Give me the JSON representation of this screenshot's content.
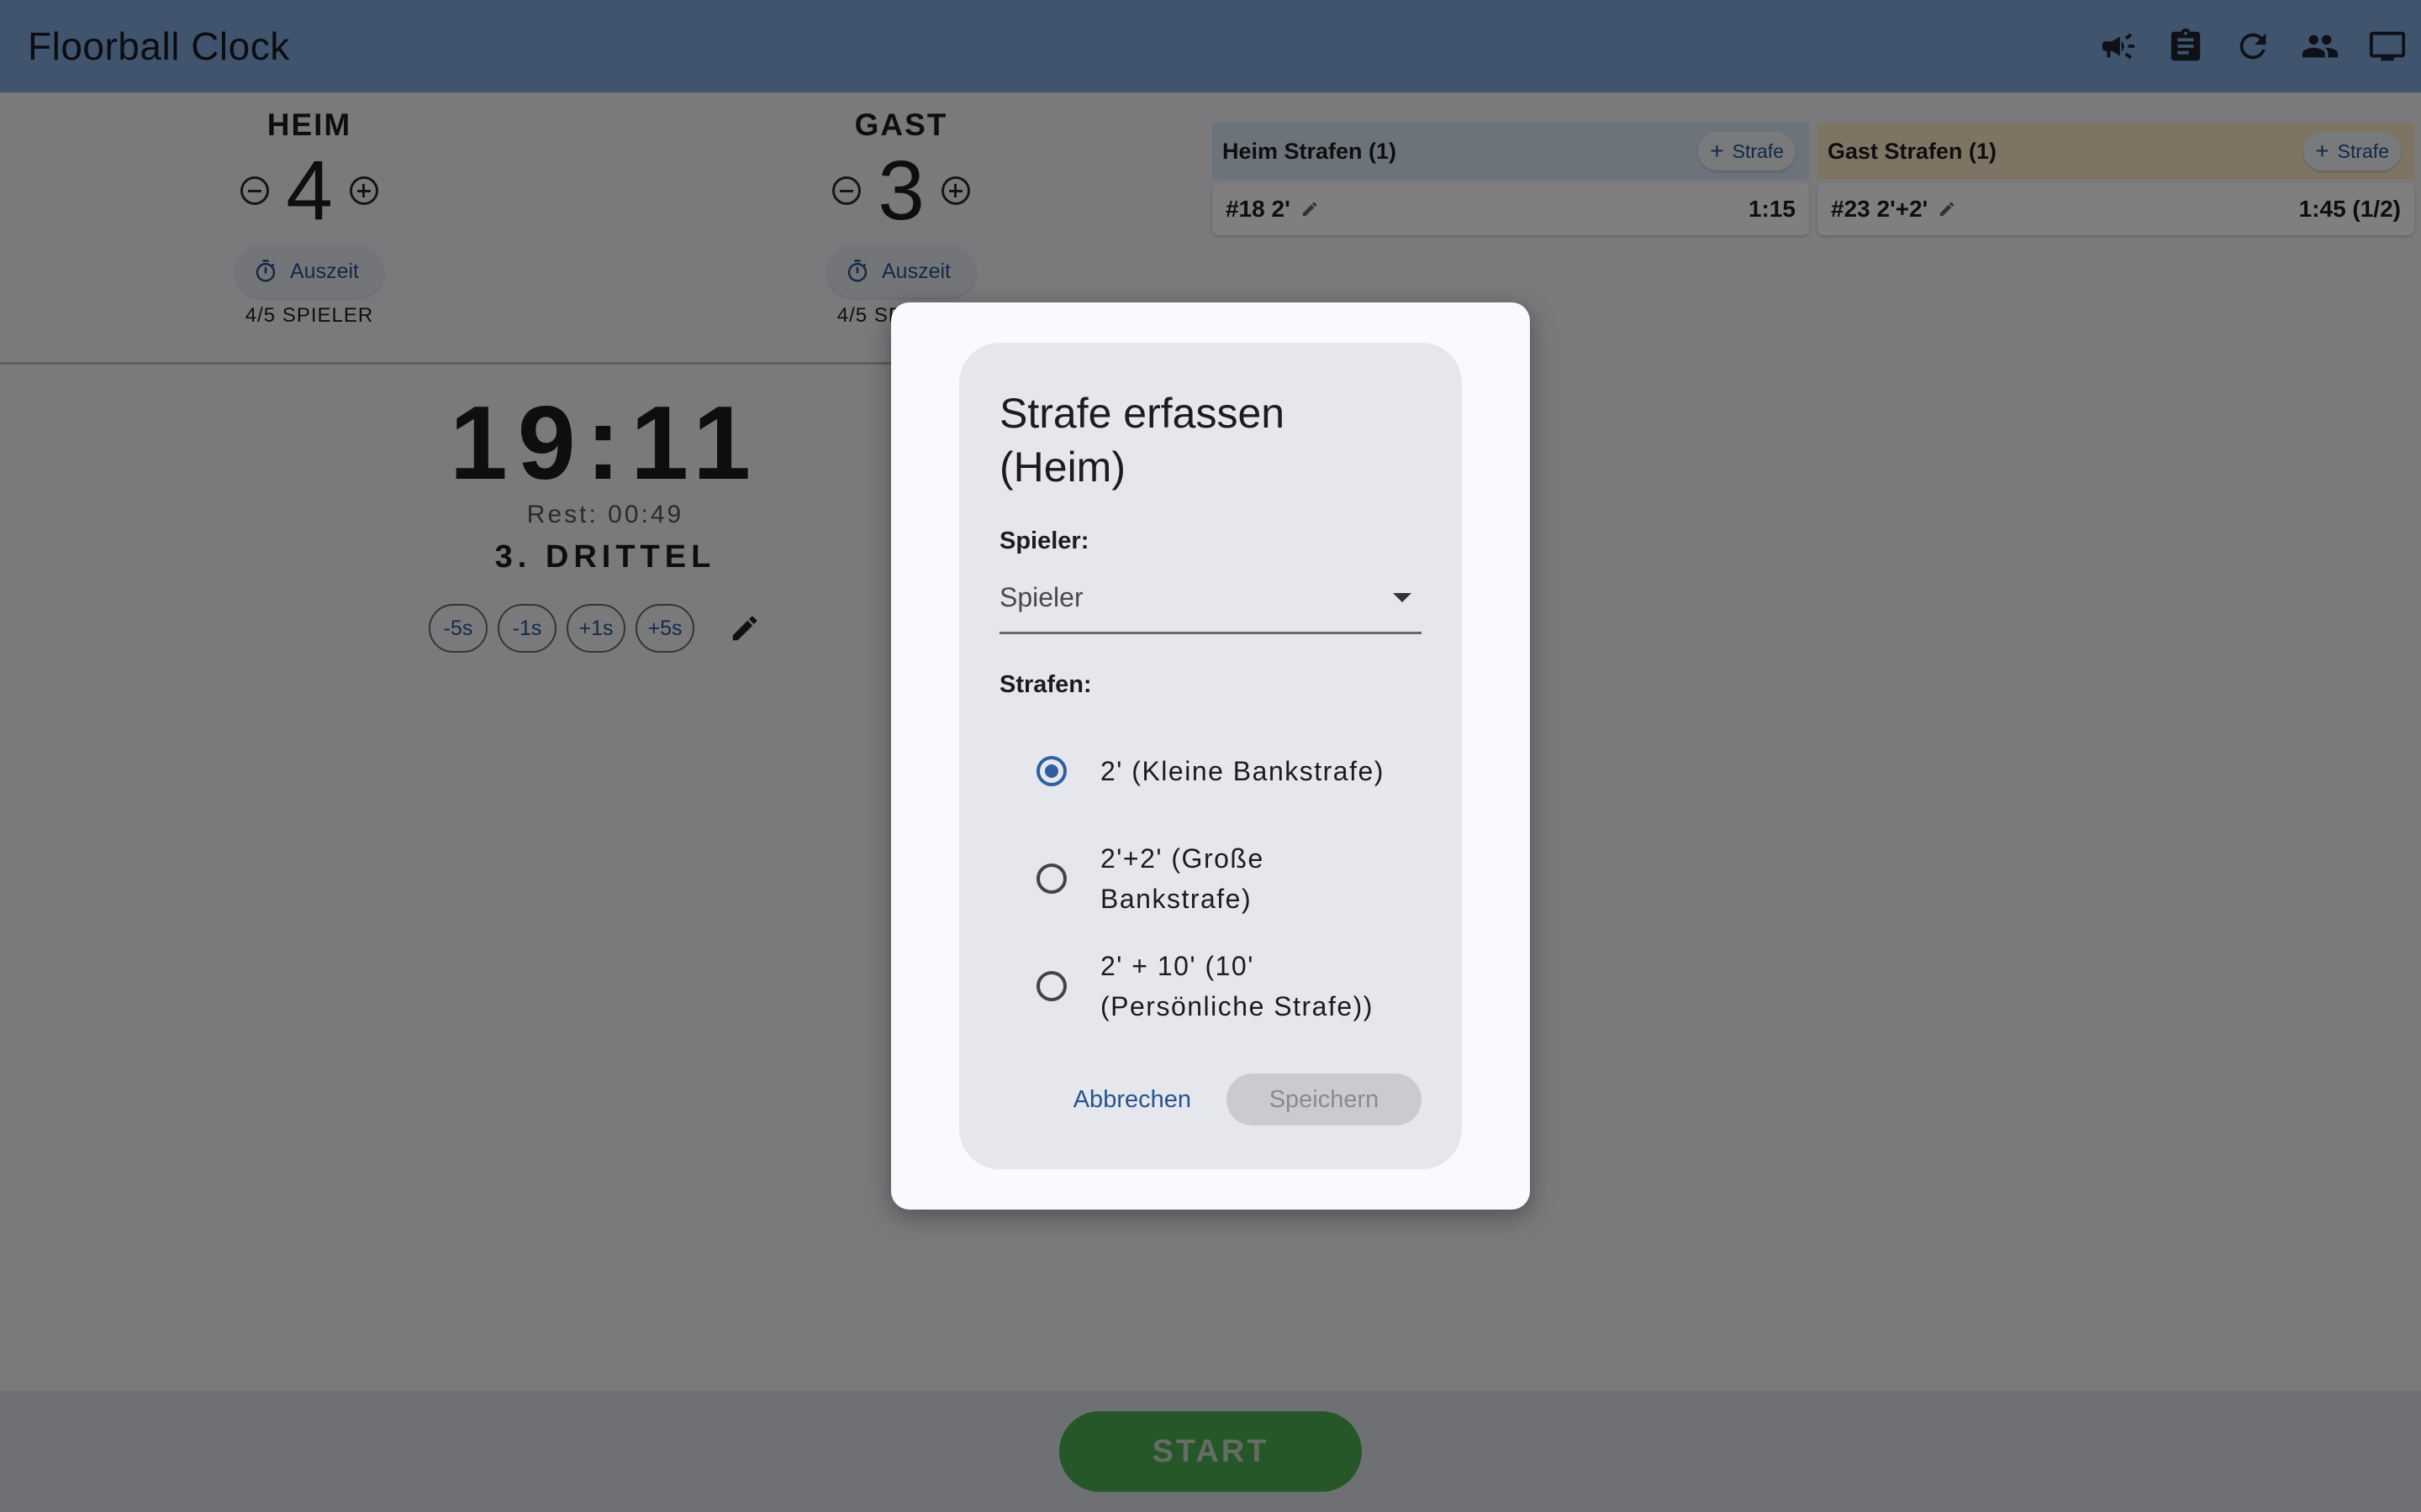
{
  "app": {
    "title": "Floorball Clock",
    "toolbar_icons": [
      "megaphone-icon",
      "clipboard-icon",
      "refresh-icon",
      "people-icon",
      "monitor-icon"
    ]
  },
  "home": {
    "name": "HEIM",
    "score": "4",
    "timeout_label": "Auszeit",
    "players": "4/5 SPIELER"
  },
  "guest": {
    "name": "GAST",
    "score": "3",
    "timeout_label": "Auszeit",
    "players": "4/5 SPIELER"
  },
  "clock": {
    "time": "19:11",
    "rest": "Rest: 00:49",
    "period": "3. DRITTEL",
    "adjust_buttons": [
      "-5s",
      "-1s",
      "+1s",
      "+5s"
    ]
  },
  "penalties": {
    "home": {
      "header": "Heim Strafen (1)",
      "add_label": "Strafe",
      "rows": [
        {
          "label": "#18 2'",
          "time": "1:15"
        }
      ]
    },
    "guest": {
      "header": "Gast Strafen (1)",
      "add_label": "Strafe",
      "rows": [
        {
          "label": "#23 2'+2'",
          "time": "1:45 (1/2)"
        }
      ]
    }
  },
  "start_label": "START",
  "dialog": {
    "title": "Strafe erfassen (Heim)",
    "player_label": "Spieler:",
    "player_placeholder": "Spieler",
    "penalties_label": "Strafen:",
    "options": [
      {
        "label": "2' (Kleine Bankstrafe)",
        "selected": true
      },
      {
        "label": "2'+2' (Große Bankstrafe)",
        "selected": false
      },
      {
        "label": "2' + 10' (10' (Persönliche Strafe))",
        "selected": false
      }
    ],
    "cancel_label": "Abbrechen",
    "save_label": "Speichern"
  },
  "colors": {
    "topbar": "#80a8dc",
    "accent": "#26548f",
    "start": "#4caf50",
    "home_penalty_header": "#dbe6f6",
    "guest_penalty_header": "#fbe9c8"
  }
}
